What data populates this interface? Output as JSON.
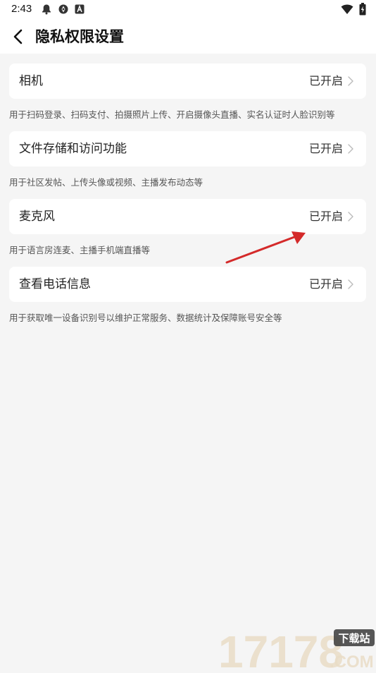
{
  "status_bar": {
    "time": "2:43"
  },
  "header": {
    "title": "隐私权限设置"
  },
  "permissions": [
    {
      "title": "相机",
      "status": "已开启",
      "description": "用于扫码登录、扫码支付、拍摄照片上传、开启摄像头直播、实名认证时人脸识别等"
    },
    {
      "title": "文件存储和访问功能",
      "status": "已开启",
      "description": "用于社区发帖、上传头像或视频、主播发布动态等"
    },
    {
      "title": "麦克风",
      "status": "已开启",
      "description": "用于语言房连麦、主播手机端直播等"
    },
    {
      "title": "查看电话信息",
      "status": "已开启",
      "description": "用于获取唯一设备识别号以维护正常服务、数据统计及保障账号安全等"
    }
  ],
  "watermark": {
    "number": "17178",
    "badge": "下载站",
    "domain": ".COM"
  },
  "colors": {
    "page_bg": "#f5f5f5",
    "card_bg": "#ffffff",
    "annotation_arrow": "#d42a2a"
  },
  "icons": {
    "back": "chevron-left-icon",
    "row_arrow": "chevron-right-icon",
    "status_left": [
      "notification-bell-icon",
      "sync-icon",
      "app-a-icon"
    ],
    "status_right": [
      "wifi-icon",
      "battery-charging-icon"
    ]
  }
}
